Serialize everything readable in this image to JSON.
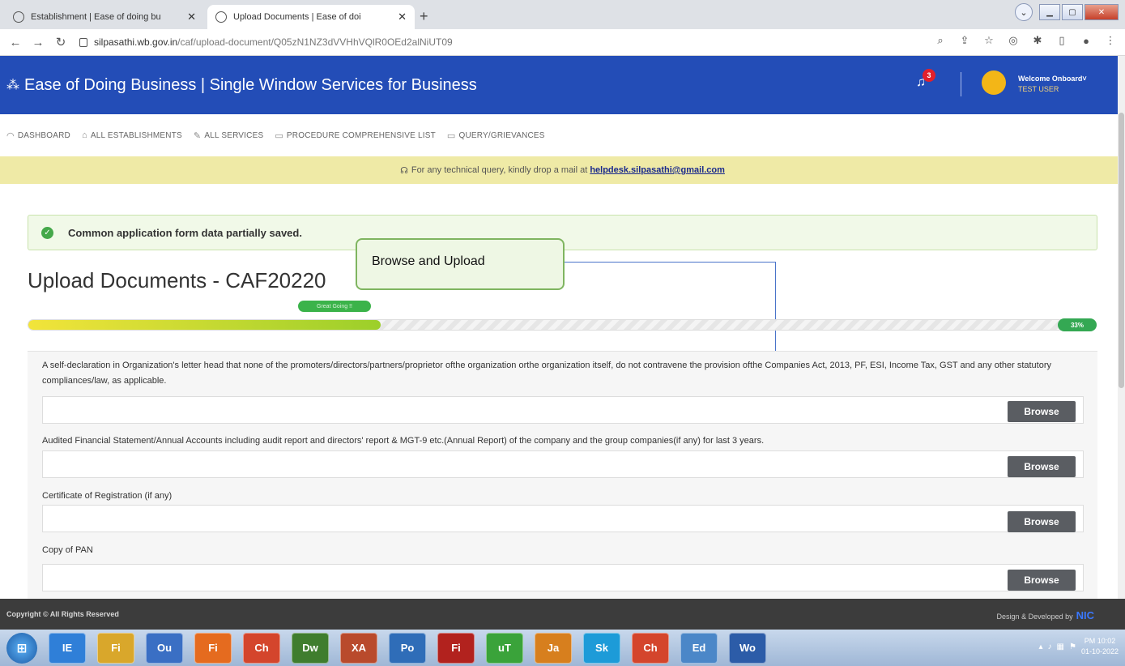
{
  "browser": {
    "tabs": [
      {
        "title": "Establishment | Ease of doing bu",
        "active": false
      },
      {
        "title": "Upload Documents | Ease of doi",
        "active": true
      }
    ],
    "url_host": "silpasathi.wb.gov.in",
    "url_path": "/caf/upload-document/Q05zN1NZ3dVVHhVQlR0OEd2alNiUT09"
  },
  "header": {
    "title": "Ease of Doing Business | Single Window Services for Business",
    "notification_count": "3",
    "welcome": "Welcome Onboard",
    "user": "TEST USER"
  },
  "menu": [
    {
      "label": "DASHBOARD",
      "icon": "dashboard-icon"
    },
    {
      "label": "ALL ESTABLISHMENTS",
      "icon": "building-icon"
    },
    {
      "label": "ALL SERVICES",
      "icon": "wrench-icon"
    },
    {
      "label": "PROCEDURE COMPREHENSIVE LIST",
      "icon": "list-icon"
    },
    {
      "label": "QUERY/GRIEVANCES",
      "icon": "message-icon"
    }
  ],
  "notice": {
    "text": "For any technical query, kindly drop a mail at",
    "email": "helpdesk.silpasathi@gmail.com"
  },
  "alert": {
    "text": "Common application form data partially saved."
  },
  "page": {
    "title": "Upload Documents - CAF20220"
  },
  "callout": {
    "text": "Browse and Upload"
  },
  "progress": {
    "label": "Great Going !!",
    "percent_text": "33%",
    "percent": 33
  },
  "documents": [
    {
      "label": "A self-declaration in Organization's letter head that none of the promoters/directors/partners/proprietor ofthe organization orthe organization itself, do not contravene the provision ofthe Companies Act, 2013, PF, ESI, Income Tax, GST and any other statutory compliances/law, as applicable.",
      "button": "Browse"
    },
    {
      "label": "Audited Financial Statement/Annual Accounts including audit report and directors' report & MGT-9 etc.(Annual Report) of the company and the group companies(if any) for last 3 years.",
      "button": "Browse"
    },
    {
      "label": "Certificate of Registration (if any)",
      "button": "Browse"
    },
    {
      "label": "Copy of PAN",
      "button": "Browse"
    }
  ],
  "footer": {
    "copyright": "Copyright © All Rights Reserved",
    "design": "Design & Developed by",
    "nic": "NIC"
  },
  "taskbar": {
    "apps": [
      "IE",
      "Files",
      "Outlook",
      "Firefox",
      "Chrome",
      "Dw",
      "XAMPP",
      "PostgreSQL",
      "FileZilla",
      "uTorrent",
      "Java",
      "Skype",
      "Chrome",
      "Edit",
      "Word"
    ],
    "time": "PM 10:02",
    "date": "01-10-2022"
  }
}
